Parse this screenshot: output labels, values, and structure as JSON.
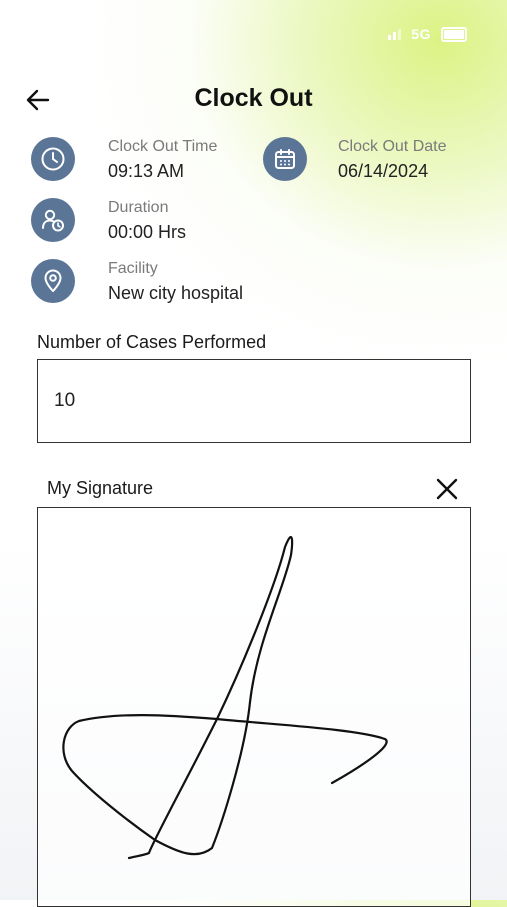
{
  "status_bar": {
    "network": "5G"
  },
  "header": {
    "title": "Clock Out"
  },
  "info": {
    "clock_out_time": {
      "label": "Clock Out Time",
      "value": "09:13 AM"
    },
    "clock_out_date": {
      "label": "Clock Out Date",
      "value": "06/14/2024"
    },
    "duration": {
      "label": "Duration",
      "value": "00:00 Hrs"
    },
    "facility": {
      "label": "Facility",
      "value": "New city hospital"
    }
  },
  "cases": {
    "label": "Number of Cases Performed",
    "value": "10"
  },
  "signature": {
    "label": "My Signature"
  },
  "colors": {
    "icon_bg": "#5b7596",
    "accent_gradient": "#d6f06e"
  },
  "icons": [
    "back-arrow-icon",
    "clock-icon",
    "calendar-icon",
    "user-clock-icon",
    "location-pin-icon",
    "close-icon"
  ]
}
